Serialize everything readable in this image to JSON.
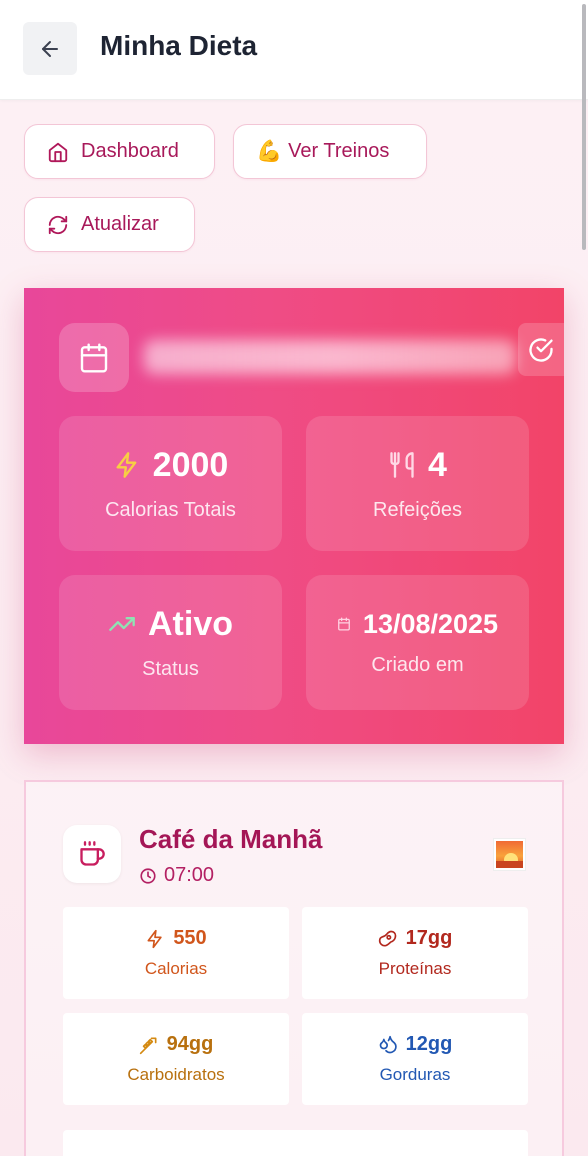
{
  "header": {
    "title": "Minha Dieta",
    "back_icon": "arrow-left-icon"
  },
  "actions": {
    "dashboard_label": "Dashboard",
    "treinos_label": "Ver Treinos",
    "treinos_emoji": "💪",
    "atualizar_label": "Atualizar"
  },
  "plan": {
    "stats": {
      "calories_value": "2000",
      "calories_label": "Calorias Totais",
      "meals_value": "4",
      "meals_label": "Refeições",
      "status_value": "Ativo",
      "status_label": "Status",
      "created_value": "13/08/2025",
      "created_label": "Criado em"
    },
    "colors": {
      "gradient_start": "#e8479a",
      "gradient_end": "#f24468"
    }
  },
  "meal": {
    "title": "Café da Manhã",
    "time": "07:00",
    "nutrients": {
      "calories_value": "550",
      "calories_label": "Calorias",
      "protein_value": "17gg",
      "protein_label": "Proteínas",
      "carbs_value": "94gg",
      "carbs_label": "Carboidratos",
      "fat_value": "12gg",
      "fat_label": "Gorduras"
    }
  }
}
